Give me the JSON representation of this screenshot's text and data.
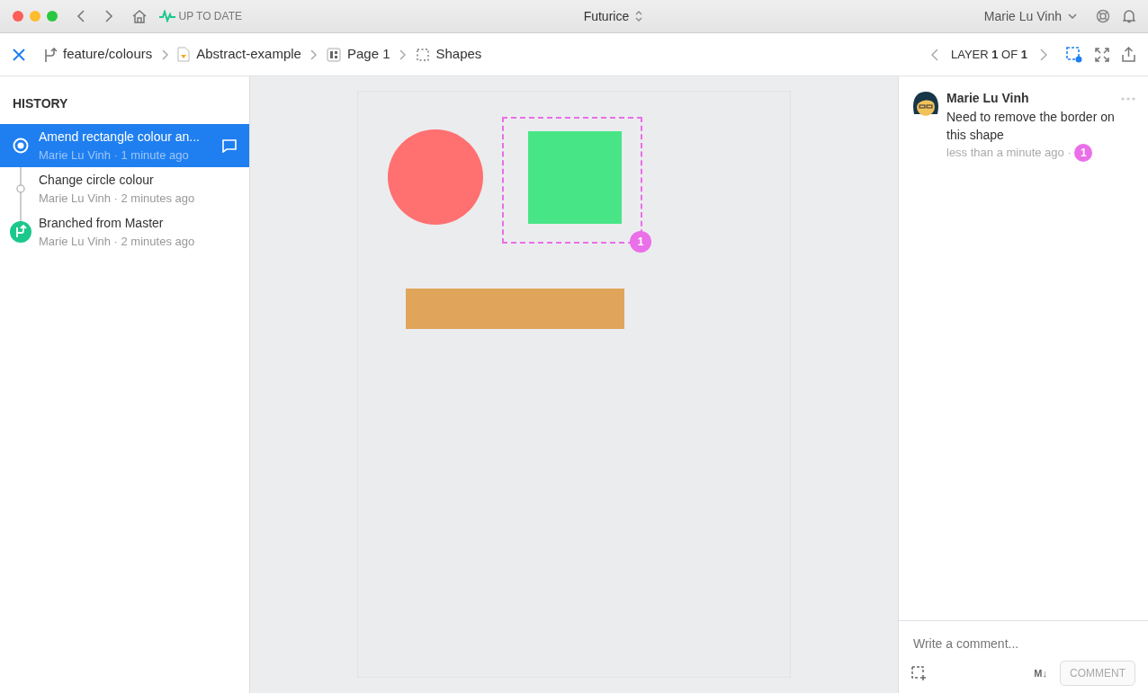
{
  "titlebar": {
    "status": "UP TO DATE",
    "project": "Futurice",
    "user": "Marie Lu Vinh"
  },
  "breadcrumbs": [
    {
      "kind": "branch",
      "label": "feature/colours"
    },
    {
      "kind": "file",
      "label": "Abstract-example"
    },
    {
      "kind": "page",
      "label": "Page 1"
    },
    {
      "kind": "artboard",
      "label": "Shapes"
    }
  ],
  "layer_nav": {
    "label": "LAYER **1** OF **1**"
  },
  "history": {
    "title": "HISTORY",
    "items": [
      {
        "kind": "commit",
        "title": "Amend rectangle colour an...",
        "meta": "Marie Lu Vinh · 1 minute ago",
        "selected": true,
        "has_comment": true
      },
      {
        "kind": "commit",
        "title": "Change circle colour",
        "meta": "Marie Lu Vinh · 2 minutes ago",
        "selected": false,
        "has_comment": false
      },
      {
        "kind": "branch",
        "title": "Branched from Master",
        "meta": "Marie Lu Vinh · 2 minutes ago",
        "selected": false,
        "has_comment": false
      }
    ]
  },
  "canvas": {
    "shapes": [
      {
        "kind": "circle",
        "color": "#ff7070"
      },
      {
        "kind": "square",
        "color": "#48e586",
        "selected": true
      },
      {
        "kind": "rectangle",
        "color": "#e0a55b"
      }
    ],
    "pin": "1"
  },
  "comments": [
    {
      "author": "Marie Lu Vinh",
      "text": "Need to remove the border on this shape",
      "time": "less than a minute ago",
      "separator": "·",
      "pin": "1"
    }
  ],
  "composer": {
    "placeholder": "Write a comment...",
    "markdown": "M↓",
    "button": "COMMENT"
  }
}
